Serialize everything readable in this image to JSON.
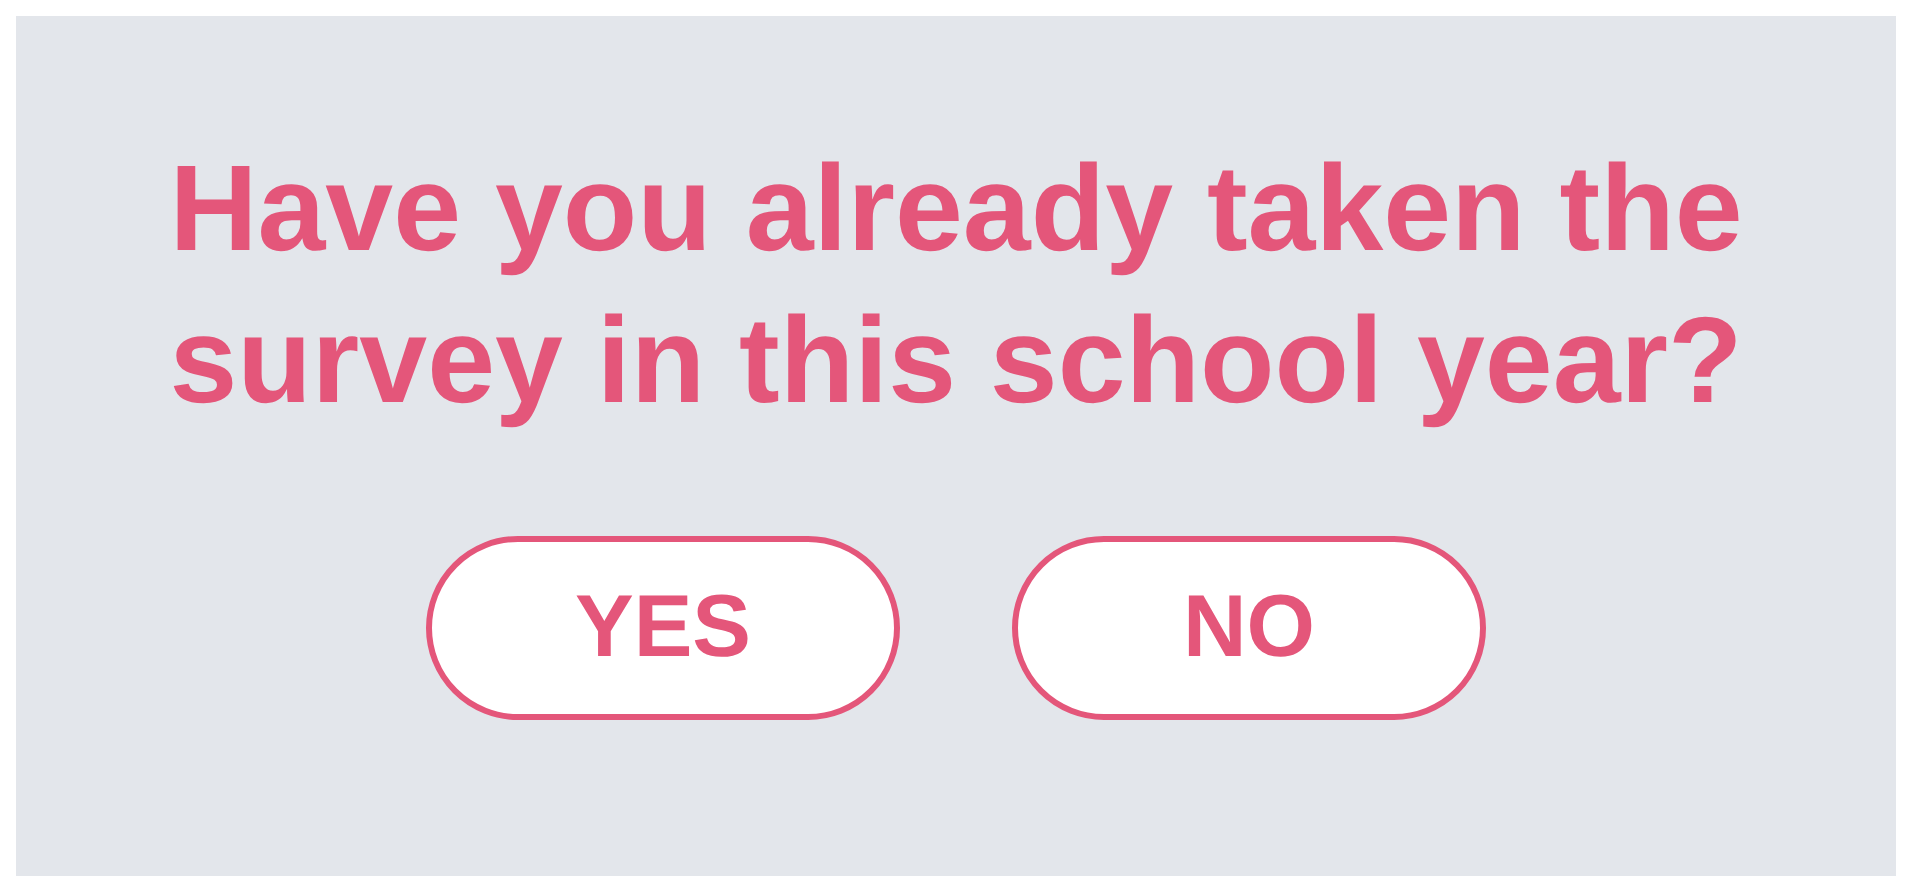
{
  "question": "Have you already taken the survey in this school year?",
  "buttons": [
    {
      "label": "YES"
    },
    {
      "label": "NO"
    }
  ]
}
